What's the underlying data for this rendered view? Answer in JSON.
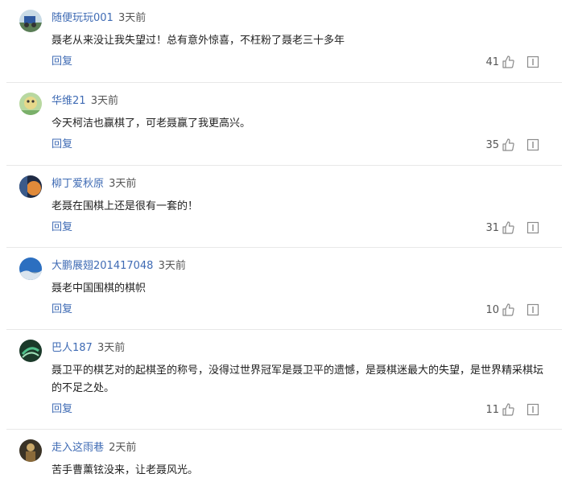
{
  "comments": [
    {
      "username": "随便玩玩001",
      "time": "3天前",
      "text": "聂老从来没让我失望过！总有意外惊喜，不枉粉了聂老三十多年",
      "reply_label": "回复",
      "likes": "41",
      "avatar": "avatar-blue-cart"
    },
    {
      "username": "华维21",
      "time": "3天前",
      "text": "今天柯洁也赢棋了，可老聂赢了我更高兴。",
      "reply_label": "回复",
      "likes": "35",
      "avatar": "avatar-green-bird"
    },
    {
      "username": "柳丁爱秋原",
      "time": "3天前",
      "text": "老聂在围棋上还是很有一套的！",
      "reply_label": "回复",
      "likes": "31",
      "avatar": "avatar-dark-orange"
    },
    {
      "username": "大鹏展翅201417048",
      "time": "3天前",
      "text": "聂老中国围棋的棋帜",
      "reply_label": "回复",
      "likes": "10",
      "avatar": "avatar-blue-sky"
    },
    {
      "username": "巴人187",
      "time": "3天前",
      "text": "聂卫平的棋艺对的起棋圣的称号，没得过世界冠军是聂卫平的遗憾，是聂棋迷最大的失望，是世界精采棋坛的不足之处。",
      "reply_label": "回复",
      "likes": "11",
      "avatar": "avatar-green-swirl"
    },
    {
      "username": "走入这雨巷",
      "time": "2天前",
      "text": "苦手曹薰铉没来，让老聂风光。",
      "reply_label": "",
      "likes": "",
      "avatar": "avatar-dark-figure"
    }
  ]
}
